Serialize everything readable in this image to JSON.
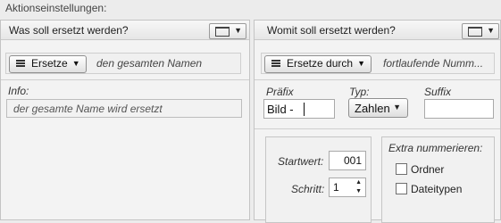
{
  "title": "Aktionseinstellungen:",
  "left": {
    "header": "Was soll ersetzt werden?",
    "mode_button": "Ersetze",
    "mode_value": "den gesamten Namen",
    "info_label": "Info:",
    "info_text": "der gesamte Name wird ersetzt"
  },
  "right": {
    "header": "Womit soll ersetzt werden?",
    "mode_button": "Ersetze durch",
    "mode_value": "fortlaufende Numm...",
    "prefix_label": "Präfix",
    "prefix_value": "Bild - ",
    "type_label": "Typ:",
    "type_value": "Zahlen",
    "suffix_label": "Suffix",
    "suffix_value": "",
    "start_label": "Startwert:",
    "start_value": "001",
    "step_label": "Schritt:",
    "step_value": "1",
    "extra_title": "Extra nummerieren:",
    "checkbox_folders": "Ordner",
    "checkbox_filetypes": "Dateitypen"
  },
  "icons": {
    "view": "window-icon",
    "chevron": "chevron-down-icon",
    "menu": "menu-icon"
  }
}
